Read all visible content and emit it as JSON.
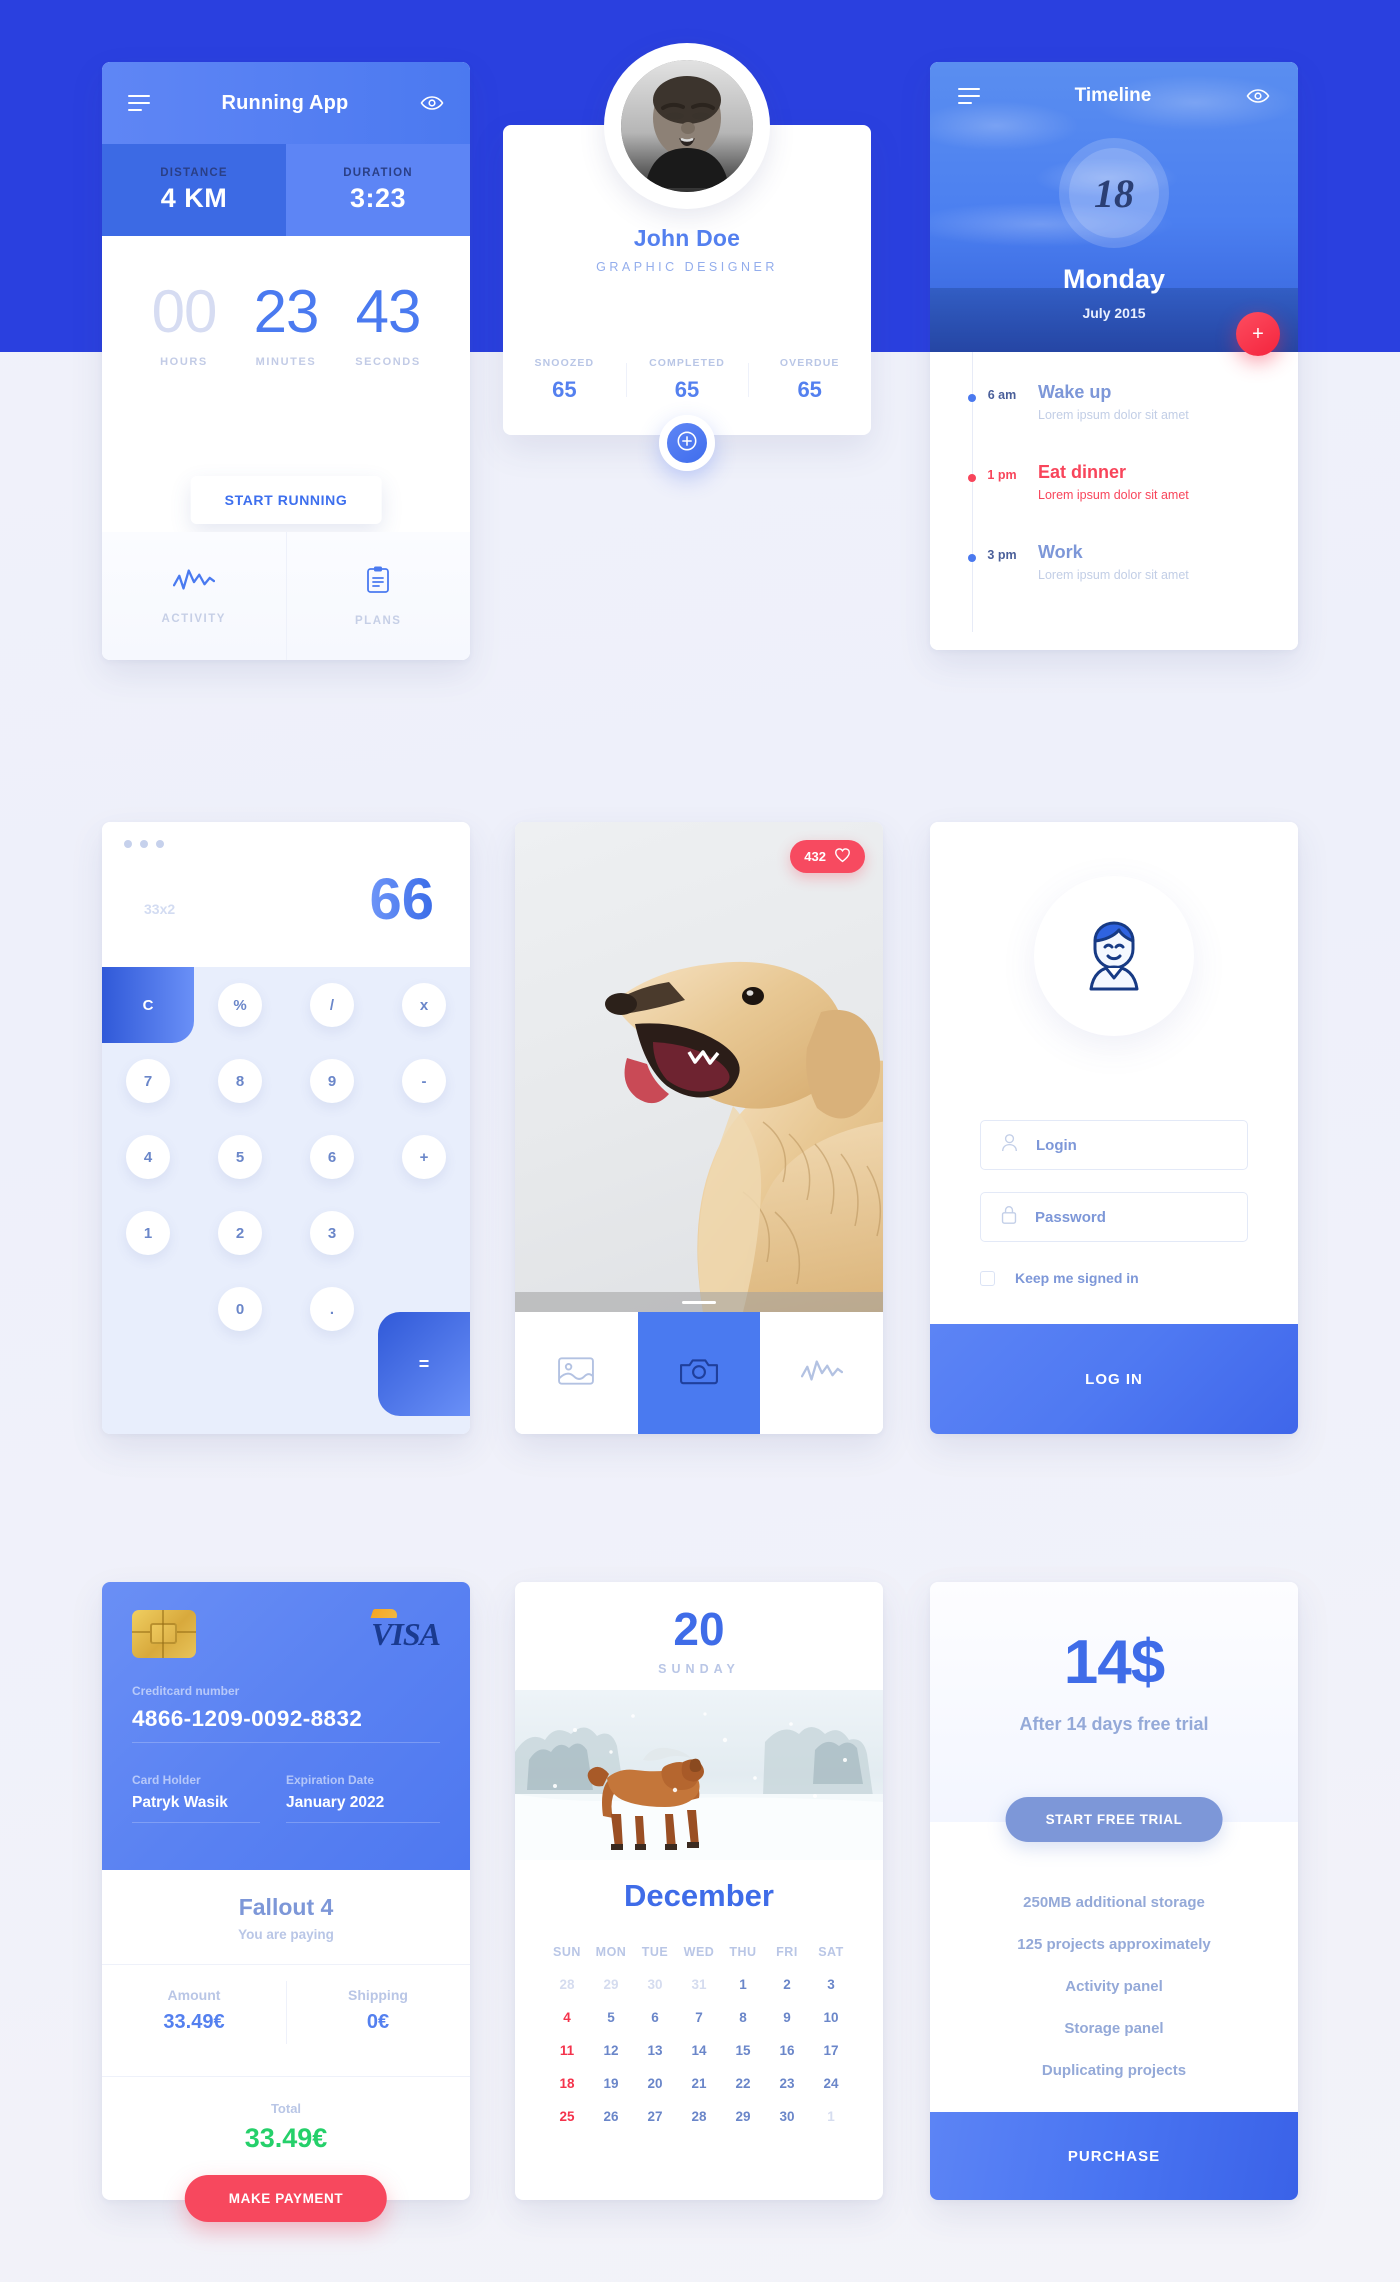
{
  "colors": {
    "page_bg": "#f1f2fa",
    "band_blue": "#2a40df",
    "accent_blue": "#3f6ce8",
    "accent_red": "#f7485e",
    "accent_green": "#25d06a",
    "muted": "#b9c6e6"
  },
  "running": {
    "title": "Running App",
    "menu_icon": "hamburger-icon",
    "eye_icon": "eye-icon",
    "stats": [
      {
        "label": "DISTANCE",
        "value": "4 KM"
      },
      {
        "label": "DURATION",
        "value": "3:23"
      }
    ],
    "fab_label": "+",
    "timer": [
      {
        "digits": "00",
        "caption": "HOURS"
      },
      {
        "digits": "23",
        "caption": "MINUTES"
      },
      {
        "digits": "43",
        "caption": "SECONDS"
      }
    ],
    "start_button": "START RUNNING",
    "tabs": [
      {
        "label": "ACTIVITY",
        "icon": "activity-chart-icon"
      },
      {
        "label": "PLANS",
        "icon": "clipboard-icon"
      }
    ]
  },
  "profile": {
    "avatar_icon": "avatar-photo",
    "name": "John Doe",
    "role": "GRAPHIC DESIGNER",
    "stats": [
      {
        "label": "SNOOZED",
        "value": "65"
      },
      {
        "label": "COMPLETED",
        "value": "65"
      },
      {
        "label": "OVERDUE",
        "value": "65"
      }
    ],
    "fab_icon": "plus-circle-icon"
  },
  "timeline": {
    "title": "Timeline",
    "menu_icon": "hamburger-icon",
    "eye_icon": "eye-icon",
    "day_number": "18",
    "day_name": "Monday",
    "month_year": "July 2015",
    "fab_label": "+",
    "items": [
      {
        "time": "6 am",
        "title": "Wake up",
        "subtitle": "Lorem ipsum dolor sit amet",
        "state": "normal"
      },
      {
        "time": "1 pm",
        "title": "Eat dinner",
        "subtitle": "Lorem ipsum dolor sit amet",
        "state": "alert"
      },
      {
        "time": "3 pm",
        "title": "Work",
        "subtitle": "Lorem ipsum dolor sit amet",
        "state": "normal"
      }
    ]
  },
  "calculator": {
    "expression": "33x2",
    "result": "66",
    "clear_key": "C",
    "equals_key": "=",
    "rows": [
      [
        "",
        "%",
        "/",
        "x"
      ],
      [
        "7",
        "8",
        "9",
        "-"
      ],
      [
        "4",
        "5",
        "6",
        "+"
      ],
      [
        "1",
        "2",
        "3",
        ""
      ],
      [
        "",
        "0",
        ".",
        ""
      ]
    ]
  },
  "photo": {
    "likes_count": "432",
    "heart_icon": "heart-icon",
    "image_alt": "golden-retriever-dog",
    "tabs": [
      {
        "icon": "image-icon",
        "active": false
      },
      {
        "icon": "camera-icon",
        "active": true
      },
      {
        "icon": "activity-chart-icon",
        "active": false
      }
    ]
  },
  "login": {
    "avatar_icon": "user-avatar-icon",
    "login_placeholder": "Login",
    "login_value": "",
    "login_icon": "person-icon",
    "password_placeholder": "Password",
    "password_value": "",
    "password_icon": "lock-icon",
    "keep_signed_label": "Keep me signed in",
    "keep_signed_checked": false,
    "submit_label": "LOG IN"
  },
  "payment": {
    "chip_icon": "card-chip-icon",
    "brand": "VISA",
    "card_number_label": "Creditcard number",
    "card_number": "4866-1209-0092-8832",
    "card_holder_label": "Card Holder",
    "card_holder": "Patryk Wasik",
    "expiration_label": "Expiration Date",
    "expiration": "January 2022",
    "product": "Fallout 4",
    "paying_note": "You are paying",
    "amount_label": "Amount",
    "amount_value": "33.49€",
    "shipping_label": "Shipping",
    "shipping_value": "0€",
    "total_label": "Total",
    "total_value": "33.49€",
    "pay_button": "MAKE PAYMENT"
  },
  "calendar": {
    "day_number": "20",
    "day_name": "SUNDAY",
    "image_alt": "horse-in-snow",
    "month": "December",
    "weekdays": [
      "SUN",
      "MON",
      "TUE",
      "WED",
      "THU",
      "FRI",
      "SAT"
    ],
    "weeks": [
      [
        {
          "d": "28",
          "t": "muted"
        },
        {
          "d": "29",
          "t": "muted"
        },
        {
          "d": "30",
          "t": "muted"
        },
        {
          "d": "31",
          "t": "muted"
        },
        {
          "d": "1",
          "t": "normal"
        },
        {
          "d": "2",
          "t": "normal"
        },
        {
          "d": "3",
          "t": "normal"
        }
      ],
      [
        {
          "d": "4",
          "t": "sun"
        },
        {
          "d": "5",
          "t": "normal"
        },
        {
          "d": "6",
          "t": "normal"
        },
        {
          "d": "7",
          "t": "normal"
        },
        {
          "d": "8",
          "t": "normal"
        },
        {
          "d": "9",
          "t": "normal"
        },
        {
          "d": "10",
          "t": "normal"
        }
      ],
      [
        {
          "d": "11",
          "t": "sun"
        },
        {
          "d": "12",
          "t": "normal"
        },
        {
          "d": "13",
          "t": "normal"
        },
        {
          "d": "14",
          "t": "normal"
        },
        {
          "d": "15",
          "t": "normal"
        },
        {
          "d": "16",
          "t": "normal"
        },
        {
          "d": "17",
          "t": "normal"
        }
      ],
      [
        {
          "d": "18",
          "t": "sun"
        },
        {
          "d": "19",
          "t": "normal"
        },
        {
          "d": "20",
          "t": "normal"
        },
        {
          "d": "21",
          "t": "normal"
        },
        {
          "d": "22",
          "t": "normal"
        },
        {
          "d": "23",
          "t": "normal"
        },
        {
          "d": "24",
          "t": "normal"
        }
      ],
      [
        {
          "d": "25",
          "t": "sun"
        },
        {
          "d": "26",
          "t": "normal"
        },
        {
          "d": "27",
          "t": "normal"
        },
        {
          "d": "28",
          "t": "normal"
        },
        {
          "d": "29",
          "t": "normal"
        },
        {
          "d": "30",
          "t": "normal"
        },
        {
          "d": "1",
          "t": "muted"
        }
      ]
    ]
  },
  "pricing": {
    "price": "14$",
    "subtitle": "After 14 days free trial",
    "trial_button": "START FREE TRIAL",
    "features": [
      "250MB additional storage",
      "125 projects approximately",
      "Activity panel",
      "Storage panel",
      "Duplicating projects"
    ],
    "purchase_button": "PURCHASE"
  }
}
